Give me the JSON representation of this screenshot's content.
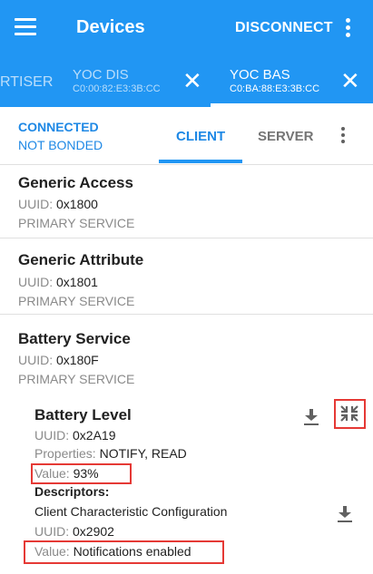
{
  "appbar": {
    "title": "Devices",
    "disconnect_label": "DISCONNECT"
  },
  "device_tabs": [
    {
      "name": "RTISER",
      "address": ""
    },
    {
      "name": "YOC DIS",
      "address": "C0:00:82:E3:3B:CC",
      "close": "✕"
    },
    {
      "name": "YOC BAS",
      "address": "C0:BA:88:E3:3B:CC",
      "close": "✕",
      "selected": true
    }
  ],
  "connection": {
    "state": "CONNECTED",
    "bond": "NOT BONDED"
  },
  "mode_tabs": {
    "client": "CLIENT",
    "server": "SERVER",
    "selected": "CLIENT"
  },
  "services": [
    {
      "name": "Generic Access",
      "uuid_label": "UUID:",
      "uuid": "0x1800",
      "type": "PRIMARY SERVICE"
    },
    {
      "name": "Generic Attribute",
      "uuid_label": "UUID:",
      "uuid": "0x1801",
      "type": "PRIMARY SERVICE"
    },
    {
      "name": "Battery Service",
      "uuid_label": "UUID:",
      "uuid": "0x180F",
      "type": "PRIMARY SERVICE"
    }
  ],
  "characteristic": {
    "name": "Battery Level",
    "uuid_label": "UUID:",
    "uuid": "0x2A19",
    "properties_label": "Properties:",
    "properties": "NOTIFY, READ",
    "value_label": "Value:",
    "value": "93%",
    "descriptors_label": "Descriptors:",
    "descriptor": {
      "name": "Client Characteristic Configuration",
      "uuid_label": "UUID:",
      "uuid": "0x2902",
      "value_label": "Value:",
      "value": "Notifications enabled"
    }
  },
  "icons": {
    "read": "download-icon",
    "notify": "notifications-disable-icon"
  },
  "colors": {
    "primary": "#2196F3",
    "accent": "#1E88E5",
    "highlight": "#e53935"
  }
}
